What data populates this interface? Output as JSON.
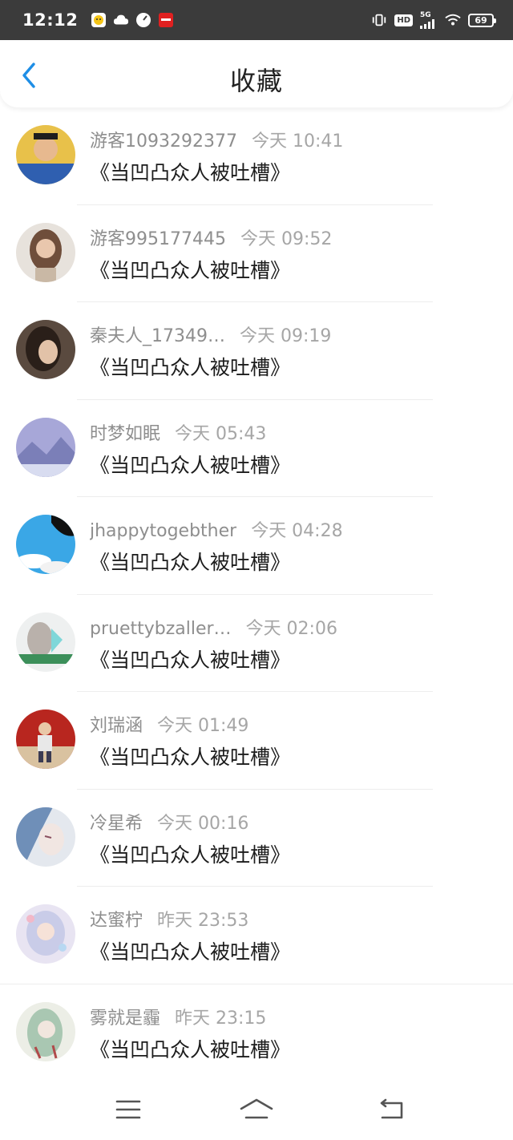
{
  "status_bar": {
    "time": "12:12",
    "notification_icons": [
      "emoji-icon",
      "cloud-icon",
      "dial-icon",
      "news-icon"
    ],
    "network": "5G",
    "hd": "HD",
    "battery": "69"
  },
  "header": {
    "title": "收藏",
    "back_icon": "chevron-left-icon",
    "accent_color": "#1e8ee6"
  },
  "items": [
    {
      "username": "游客1093292377",
      "time": "今天  10:41",
      "title": "《当凹凸众人被吐槽》"
    },
    {
      "username": "游客995177445",
      "time": "今天  09:52",
      "title": "《当凹凸众人被吐槽》"
    },
    {
      "username": "秦夫人_17349…",
      "time": "今天  09:19",
      "title": "《当凹凸众人被吐槽》"
    },
    {
      "username": "时梦如眠",
      "time": "今天  05:43",
      "title": "《当凹凸众人被吐槽》"
    },
    {
      "username": "jhappytogebther",
      "time": "今天  04:28",
      "title": "《当凹凸众人被吐槽》"
    },
    {
      "username": "pruettybzaller…",
      "time": "今天  02:06",
      "title": "《当凹凸众人被吐槽》"
    },
    {
      "username": "刘瑞涵",
      "time": "今天  01:49",
      "title": "《当凹凸众人被吐槽》"
    },
    {
      "username": "冷星希",
      "time": "今天  00:16",
      "title": "《当凹凸众人被吐槽》"
    },
    {
      "username": "达蜜柠",
      "time": "昨天  23:53",
      "title": "《当凹凸众人被吐槽》"
    },
    {
      "username": "雾就是霾",
      "time": "昨天  23:15",
      "title": "《当凹凸众人被吐槽》"
    }
  ],
  "nav_bar": {
    "menu_icon": "menu-icon",
    "home_icon": "home-icon",
    "back_icon": "back-icon"
  }
}
